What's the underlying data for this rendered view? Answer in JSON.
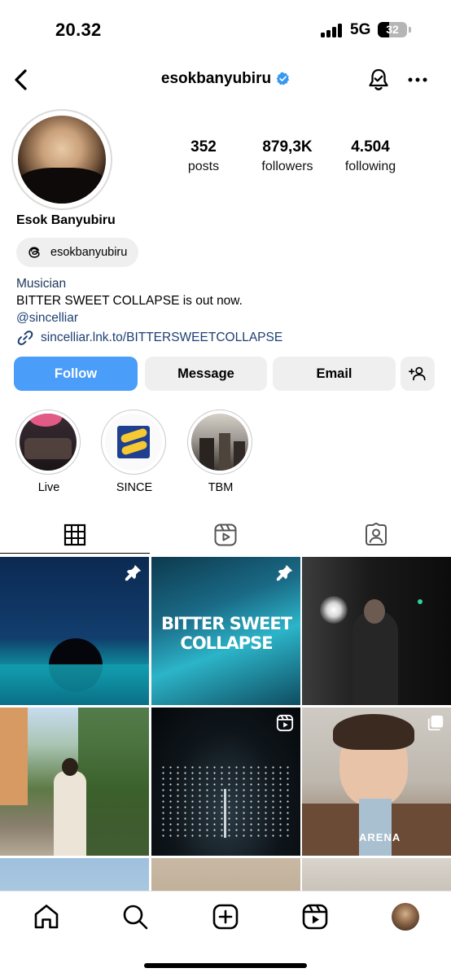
{
  "status_bar": {
    "time": "20.32",
    "network": "5G",
    "battery": "32",
    "battery_level": 0.32
  },
  "header": {
    "username": "esokbanyubiru",
    "verified": true,
    "icons": [
      "back-chevron-icon",
      "notification-bell-icon",
      "more-horizontal-icon"
    ]
  },
  "profile": {
    "display_name": "Esok Banyubiru",
    "threads_handle": "esokbanyubiru",
    "stats": [
      {
        "value": "352",
        "label": "posts"
      },
      {
        "value": "879,3K",
        "label": "followers"
      },
      {
        "value": "4.504",
        "label": "following"
      }
    ],
    "bio": {
      "category": "Musician",
      "line": "BITTER SWEET COLLAPSE is out now.",
      "mention": "@sincelliar",
      "link": "sincelliar.lnk.to/BITTERSWEETCOLLAPSE"
    }
  },
  "actions": {
    "follow": "Follow",
    "message": "Message",
    "email": "Email",
    "add_icon": "add-person-icon"
  },
  "highlights": [
    {
      "label": "Live"
    },
    {
      "label": "SINCE"
    },
    {
      "label": "TBM"
    }
  ],
  "tabs": [
    {
      "icon": "grid-icon",
      "active": true
    },
    {
      "icon": "reels-icon",
      "active": false
    },
    {
      "icon": "tagged-icon",
      "active": false
    }
  ],
  "grid": {
    "post_2_text": "BITTER SWEET COLLAPSE",
    "post_6_text": "ARENA",
    "badges": [
      "pin-icon",
      "pin-icon",
      "",
      "",
      "reel-icon",
      "carousel-icon"
    ]
  },
  "colors": {
    "follow_blue": "#4a9df8",
    "verified_blue": "#3897f0",
    "link_blue": "#1d3f73"
  },
  "bottom_nav": [
    "home-icon",
    "search-icon",
    "create-icon",
    "reels-icon",
    "profile-avatar"
  ]
}
